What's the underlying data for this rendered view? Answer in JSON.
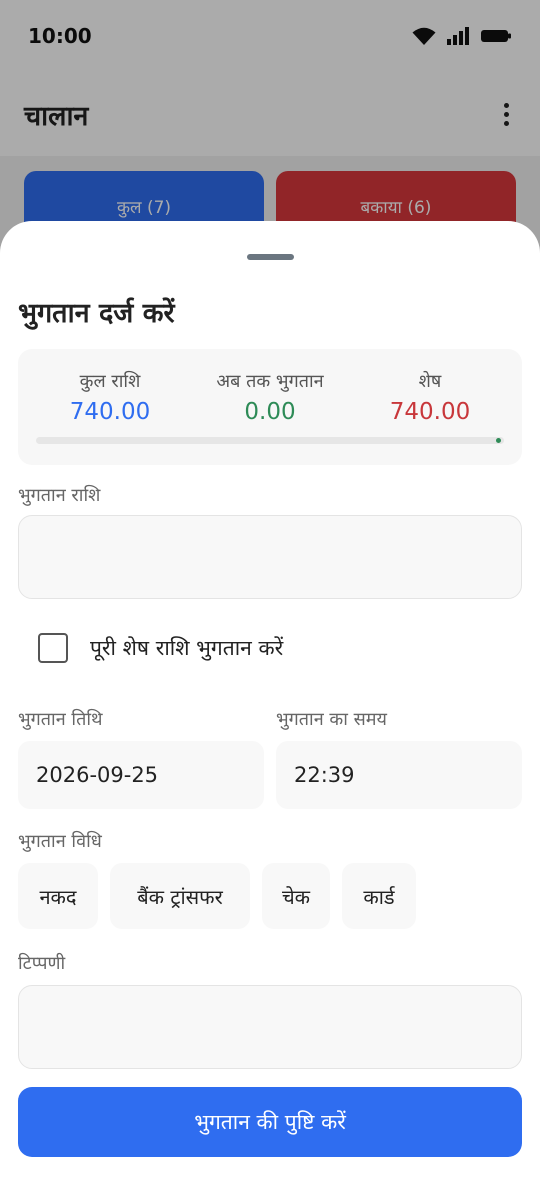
{
  "status_bar": {
    "time": "10:00",
    "icons": [
      "wifi-icon",
      "signal-icon",
      "battery-icon"
    ]
  },
  "app_bar": {
    "title": "चालान",
    "menu_icon": "more-vert-icon"
  },
  "tabs": {
    "total_label": "कुल (7)",
    "due_label": "बकाया (6)"
  },
  "sheet": {
    "title": "भुगतान दर्ज करें",
    "summary": {
      "total_label": "कुल राशि",
      "total_value": "740.00",
      "paid_label": "अब तक भुगतान",
      "paid_value": "0.00",
      "remaining_label": "शेष",
      "remaining_value": "740.00",
      "progress_fraction": 0.0
    },
    "amount_label": "भुगतान राशि",
    "amount_value": "",
    "pay_full_label": "पूरी शेष राशि भुगतान करें",
    "pay_full_checked": false,
    "date_label": "भुगतान तिथि",
    "date_value": "2026-09-25",
    "time_label": "भुगतान का समय",
    "time_value": "22:39",
    "method_label": "भुगतान विधि",
    "methods": [
      "नकद",
      "बैंक ट्रांसफर",
      "चेक",
      "कार्ड"
    ],
    "note_label": "टिप्पणी",
    "note_value": "",
    "confirm_label": "भुगतान की पुष्टि करें"
  },
  "colors": {
    "primary": "#2f6df0",
    "danger": "#d9383d",
    "total_value": "#2f6df0",
    "paid_value": "#2e8b57",
    "remaining_value": "#c8373b"
  }
}
